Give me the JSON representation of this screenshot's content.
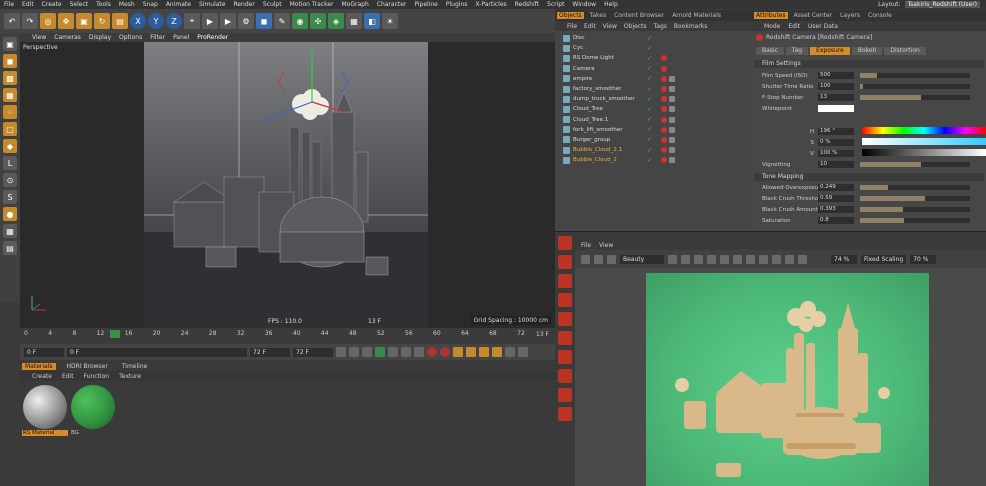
{
  "menubar": {
    "items": [
      "File",
      "Edit",
      "Create",
      "Select",
      "Tools",
      "Mesh",
      "Snap",
      "Animate",
      "Simulate",
      "Render",
      "Sculpt",
      "Motion Tracker",
      "MoGraph",
      "Character",
      "Pipeline",
      "Plugins",
      "X-Particles",
      "Redshift",
      "Script",
      "Window",
      "Help"
    ],
    "layout_label": "Layout:",
    "layout_value": "Tsakiris_Redshift (User)"
  },
  "viewport": {
    "menu": [
      "View",
      "Cameras",
      "Display",
      "Options",
      "Filter",
      "Panel",
      "ProRender"
    ],
    "label": "Perspective",
    "fps": "FPS : 110.0",
    "frame": "13 F",
    "grid_spacing": "Grid Spacing : 10000 cm"
  },
  "timeline": {
    "ticks": [
      "0",
      "4",
      "8",
      "12",
      "16",
      "20",
      "24",
      "28",
      "32",
      "36",
      "40",
      "44",
      "48",
      "52",
      "56",
      "60",
      "64",
      "68",
      "72"
    ],
    "current_frame": "13 F",
    "start_field": "0 F",
    "start2_field": "0 F",
    "end_field": "72 F",
    "end2_field": "72 F"
  },
  "materials": {
    "tabs": [
      "Materials",
      "HDRI Browser",
      "Timeline"
    ],
    "menu": [
      "Create",
      "Edit",
      "Function",
      "Texture"
    ],
    "items": [
      {
        "name": "RS Material",
        "color": "#b0b0b0"
      },
      {
        "name": "BG",
        "color": "#2e8f3e"
      }
    ]
  },
  "object_manager": {
    "tabs": [
      "Objects",
      "Takes",
      "Content Browser",
      "Arnold Materials"
    ],
    "menu": [
      "File",
      "Edit",
      "View",
      "Objects",
      "Tags",
      "Bookmarks"
    ],
    "objects": [
      {
        "name": "Disc"
      },
      {
        "name": "Cyc"
      },
      {
        "name": "RS Dome Light"
      },
      {
        "name": "Camera"
      },
      {
        "name": "empire"
      },
      {
        "name": "factory_smoother"
      },
      {
        "name": "dump_truck_smoother"
      },
      {
        "name": "Cloud_Tree"
      },
      {
        "name": "Cloud_Tree.1"
      },
      {
        "name": "fork_lift_smoother"
      },
      {
        "name": "Burger_group"
      },
      {
        "name": "Bubble_Cloud_2.1",
        "highlight": true
      },
      {
        "name": "Bubble_Cloud_2",
        "highlight": true
      }
    ]
  },
  "attributes": {
    "tabs": [
      "Attributes",
      "Asset Center",
      "Layers",
      "Console"
    ],
    "menu": [
      "Mode",
      "Edit",
      "User Data"
    ],
    "title": "Redshift Camera [Redshift Camera]",
    "subtabs": [
      "Basic",
      "Tag",
      "Exposure",
      "Bokeh",
      "Distortion"
    ],
    "film_settings": "Film Settings",
    "props": [
      {
        "label": "Film Speed (ISO)",
        "value": "500",
        "fill": 0.15
      },
      {
        "label": "Shutter Time Ratio",
        "value": "100",
        "fill": 0.03
      },
      {
        "label": "F-Stop Number",
        "value": "13",
        "fill": 0.55
      },
      {
        "label": "Whitepoint",
        "value": ""
      }
    ],
    "hsv": [
      {
        "label": "H",
        "value": "196 °"
      },
      {
        "label": "S",
        "value": "0 %"
      },
      {
        "label": "V",
        "value": "100 %"
      }
    ],
    "vignetting": {
      "label": "Vignetting",
      "value": "10",
      "fill": 0.55
    },
    "tone_mapping": "Tone Mapping",
    "tone_props": [
      {
        "label": "Allowed Overexposure",
        "value": "0.249",
        "fill": 0.25
      },
      {
        "label": "Black Crush Threshold",
        "value": "0.59",
        "fill": 0.59
      },
      {
        "label": "Black Crush Amount",
        "value": "0.393",
        "fill": 0.39
      },
      {
        "label": "Saturation",
        "value": "0.8",
        "fill": 0.4
      }
    ]
  },
  "render_view": {
    "menu": [
      "File",
      "View"
    ],
    "beauty": "Beauty",
    "zoom": "74 %",
    "scaling": "Fixed Scaling",
    "scaling_value": "70 %"
  },
  "colors": {
    "accent": "#d78a2a",
    "render_bg": "#4cb877"
  }
}
